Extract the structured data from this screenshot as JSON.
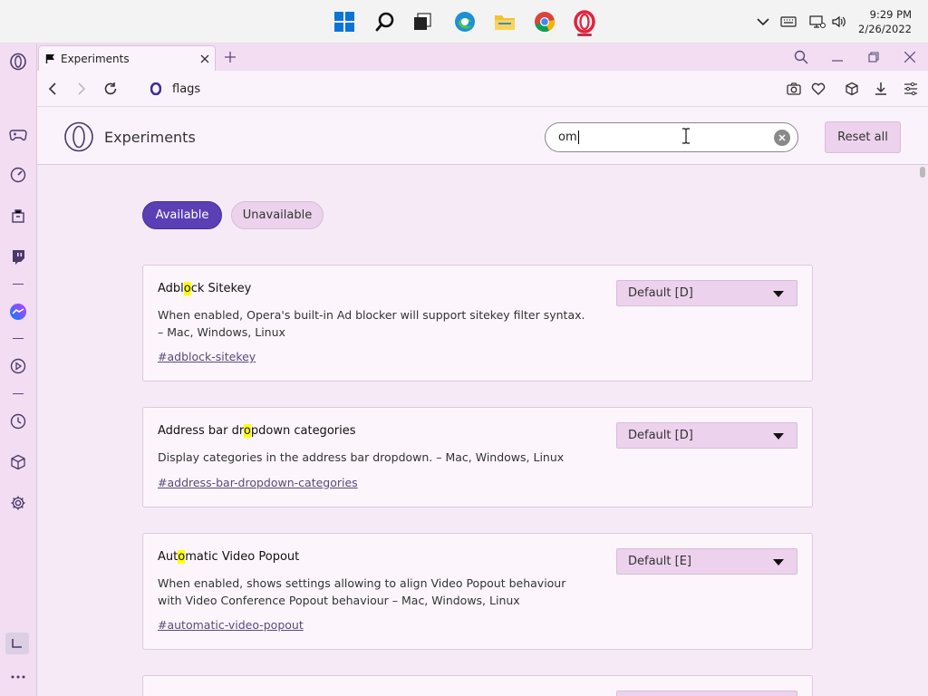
{
  "taskbar": {
    "time": "9:29 PM",
    "date": "2/26/2022"
  },
  "tab": {
    "title": "Experiments"
  },
  "address": {
    "url": "flags"
  },
  "page": {
    "title": "Experiments",
    "search_value": "om",
    "reset_label": "Reset all",
    "filter_available": "Available",
    "filter_unavailable": "Unavailable"
  },
  "flags": [
    {
      "title_pre": "Adbl",
      "title_hl": "o",
      "title_post": "ck Sitekey",
      "description": "When enabled, Opera's built-in Ad blocker will support sitekey filter syntax. – Mac, Windows, Linux",
      "link": "#adblock-sitekey",
      "value": "Default [D]"
    },
    {
      "title_pre": "Address bar dr",
      "title_hl": "o",
      "title_post": "pdown categories",
      "description": "Display categories in the address bar dropdown. – Mac, Windows, Linux",
      "link": "#address-bar-dropdown-categories",
      "value": "Default [D]"
    },
    {
      "title_pre": "Aut",
      "title_hl": "o",
      "title_post": "matic Video Popout",
      "description": "When enabled, shows settings allowing to align Video Popout behaviour with Video Conference Popout behaviour – Mac, Windows, Linux",
      "link": "#automatic-video-popout",
      "value": "Default [E]"
    }
  ]
}
